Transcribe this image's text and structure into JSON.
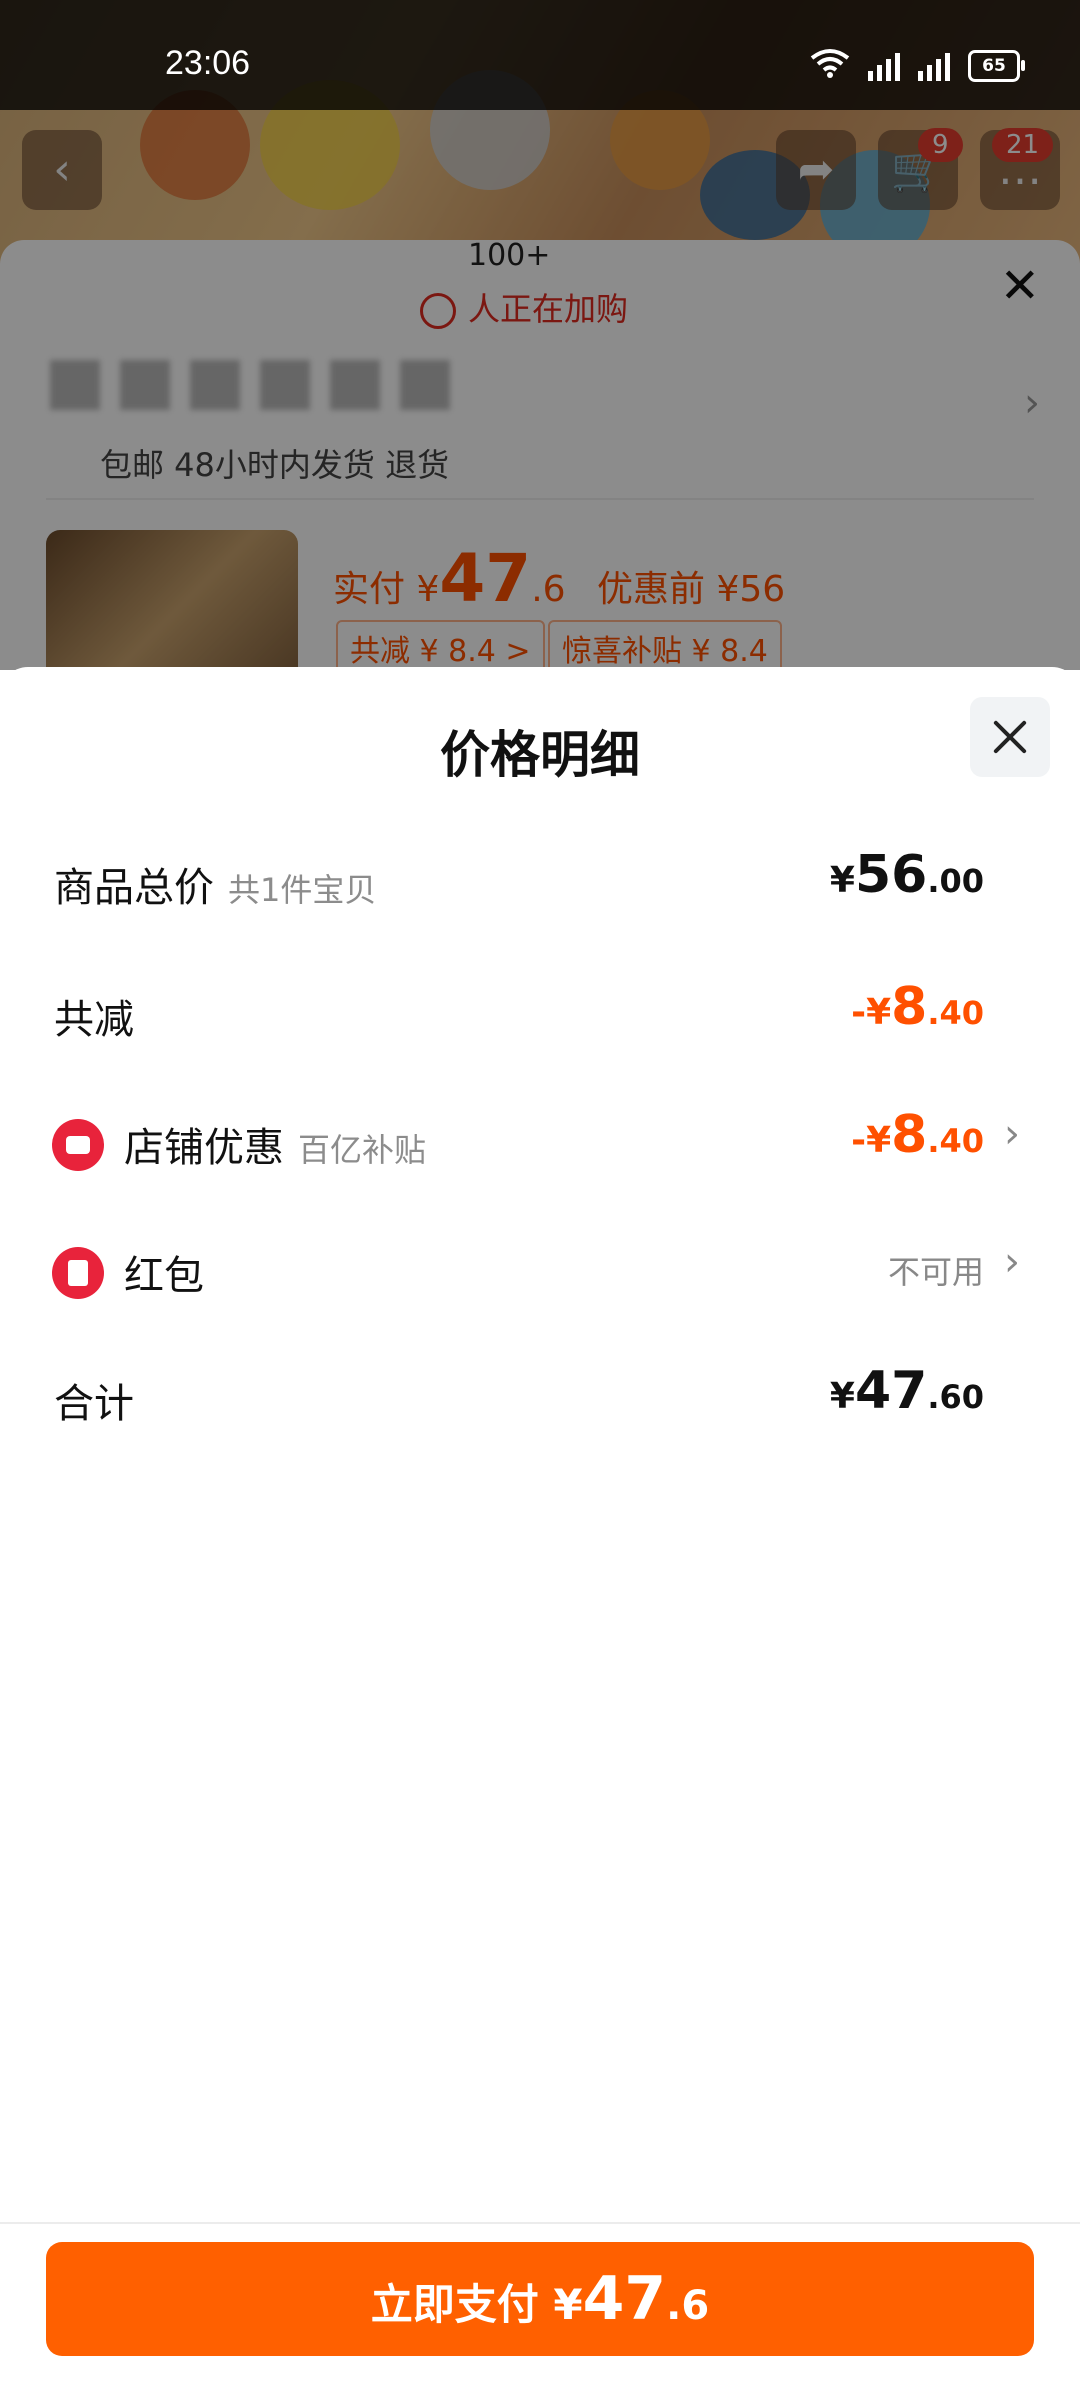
{
  "status_bar": {
    "time": "23:06",
    "battery": "65"
  },
  "background": {
    "alarm_count": "100+",
    "alarm_text": "人正在加购",
    "shipping_text": "包邮 48小时内发货 退货",
    "pay_prefix": "实付 ¥",
    "pay_integer": "47",
    "pay_decimal": ".6",
    "before_price": "优惠前 ¥56",
    "chip_discount": "共减 ¥ 8.4 >",
    "chip_subsidy": "惊喜补贴 ¥ 8.4",
    "badge_cart": "9",
    "badge_msg": "21"
  },
  "sheet": {
    "title": "价格明细",
    "rows": [
      {
        "label": "商品总价",
        "sub": "共1件宝贝",
        "currency": "¥",
        "integer": "56",
        "decimal": ".00"
      },
      {
        "label": "共减",
        "currency": "-¥",
        "integer": "8",
        "decimal": ".40"
      },
      {
        "label": "店铺优惠",
        "sub": "百亿补贴",
        "currency": "-¥",
        "integer": "8",
        "decimal": ".40"
      },
      {
        "label": "红包",
        "status": "不可用"
      },
      {
        "label": "合计",
        "currency": "¥",
        "integer": "47",
        "decimal": ".60"
      }
    ]
  },
  "pay_button": {
    "label": "立即支付 ",
    "currency": "¥",
    "integer": "47",
    "decimal": ".6"
  },
  "colors": {
    "accent": "#ff5000",
    "button": "#ff6000",
    "icon_red": "#e8233b"
  }
}
